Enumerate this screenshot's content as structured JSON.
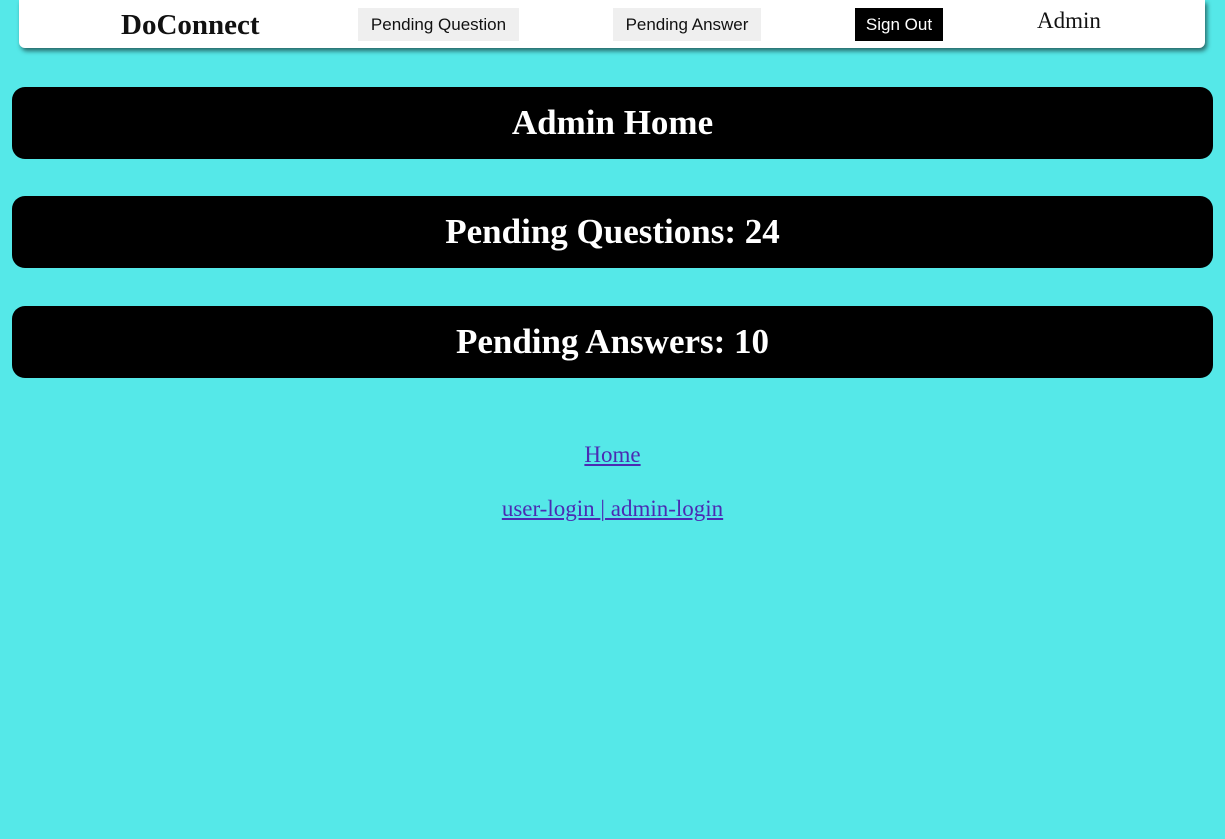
{
  "navbar": {
    "brand": "DoConnect",
    "pending_question_label": "Pending Question",
    "pending_answer_label": "Pending Answer",
    "sign_out_label": "Sign Out",
    "user_label": "Admin"
  },
  "main": {
    "title": "Admin Home",
    "pending_questions": "Pending Questions: 24",
    "pending_answers": "Pending Answers: 10"
  },
  "footer": {
    "home_link": "Home",
    "user_login_link": "user-login ",
    "separator": "|",
    "admin_login_link": " admin-login"
  },
  "colors": {
    "background": "#55e8e8",
    "banner": "#000000",
    "link": "#4b2bb3"
  }
}
